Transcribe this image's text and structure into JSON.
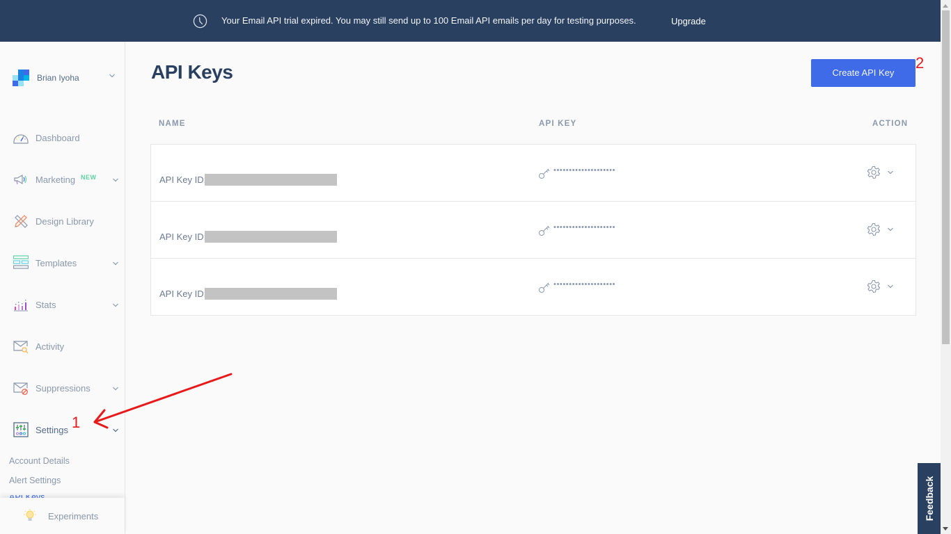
{
  "banner": {
    "icon": "clock-icon",
    "message": "Your Email API trial expired. You may still send up to 100 Email API emails per day for testing purposes.",
    "upgrade_label": "Upgrade"
  },
  "account": {
    "name": "Brian Iyoha"
  },
  "sidebar": {
    "items": [
      {
        "label": "Dashboard",
        "icon": "dashboard-gauge-icon",
        "has_chevron": false
      },
      {
        "label": "Marketing",
        "icon": "megaphone-icon",
        "badge": "NEW",
        "has_chevron": true
      },
      {
        "label": "Design Library",
        "icon": "design-pencil-ruler-icon",
        "has_chevron": false
      },
      {
        "label": "Templates",
        "icon": "templates-icon",
        "has_chevron": true
      },
      {
        "label": "Stats",
        "icon": "stats-chart-icon",
        "has_chevron": true
      },
      {
        "label": "Activity",
        "icon": "envelope-search-icon",
        "has_chevron": false
      },
      {
        "label": "Suppressions",
        "icon": "envelope-blocked-icon",
        "has_chevron": true
      },
      {
        "label": "Settings",
        "icon": "settings-sliders-icon",
        "has_chevron": true,
        "expanded": true
      }
    ],
    "settings_subitems": [
      {
        "label": "Account Details"
      },
      {
        "label": "Alert Settings"
      },
      {
        "label": "API Keys",
        "current": true
      }
    ],
    "experiments_label": "Experiments"
  },
  "main": {
    "title": "API Keys",
    "create_button_label": "Create API Key",
    "columns": {
      "name": "NAME",
      "api_key": "API KEY",
      "action": "ACTION"
    },
    "rows": [
      {
        "id_label": "API Key ID:",
        "id_value": "[redacted]",
        "key_masked": "••••••••••••••••••••"
      },
      {
        "id_label": "API Key ID:",
        "id_value": "[redacted]",
        "key_masked": "••••••••••••••••••••"
      },
      {
        "id_label": "API Key ID:",
        "id_value": "[redacted]",
        "key_masked": "••••••••••••••••••••"
      }
    ]
  },
  "annotations": {
    "step1": "1",
    "step2": "2",
    "color": "#e8191a"
  },
  "feedback_label": "Feedback",
  "colors": {
    "banner_bg": "#294061",
    "primary_button": "#3f6ae8",
    "title": "#294061",
    "new_badge": "#5fd3a4"
  }
}
